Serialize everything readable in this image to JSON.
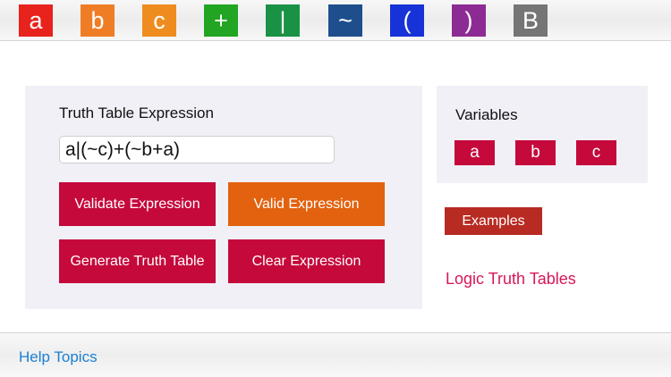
{
  "toolbar": {
    "keys": [
      {
        "label": "a",
        "color": "#e8221c"
      },
      {
        "label": "b",
        "color": "#ef7d26"
      },
      {
        "label": "c",
        "color": "#ef8c1f"
      },
      {
        "label": "+",
        "color": "#21a522"
      },
      {
        "label": "|",
        "color": "#199245"
      },
      {
        "label": "~",
        "color": "#1e4f8c"
      },
      {
        "label": "(",
        "color": "#1732d6"
      },
      {
        "label": ")",
        "color": "#8c2b94"
      },
      {
        "label": "B",
        "color": "#757575"
      }
    ]
  },
  "expression_panel": {
    "title": "Truth Table Expression",
    "input_value": "a|(~c)+(~b+a)",
    "buttons": {
      "validate": "Validate Expression",
      "valid": "Valid Expression",
      "generate": "Generate Truth Table",
      "clear": "Clear Expression"
    }
  },
  "variables_panel": {
    "title": "Variables",
    "items": [
      "a",
      "b",
      "c"
    ]
  },
  "examples_label": "Examples",
  "app_link": "Logic Truth Tables",
  "help_link": "Help Topics",
  "colors": {
    "crimson": "#c5093b",
    "orange": "#e2620f",
    "examples": "#b72b22",
    "link_pink": "#d6185a",
    "link_blue": "#1a7fd3",
    "panel_bg": "#f1f0f7"
  }
}
